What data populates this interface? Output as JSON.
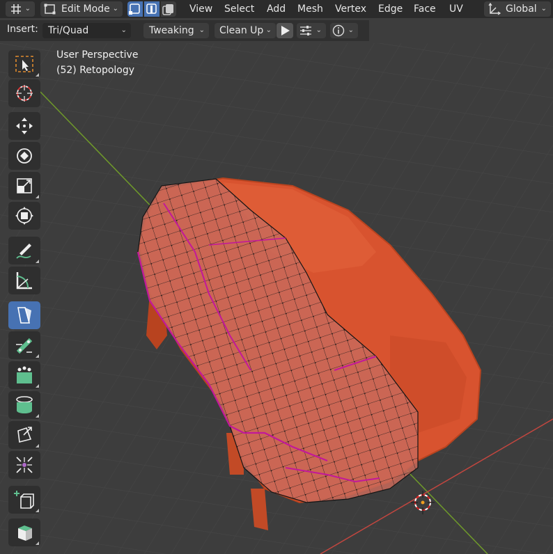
{
  "header": {
    "mode_label": "Edit Mode",
    "menus": [
      "View",
      "Select",
      "Add",
      "Mesh",
      "Vertex",
      "Edge",
      "Face",
      "UV"
    ],
    "orientation_label": "Global"
  },
  "tool_header": {
    "insert_label": "Insert:",
    "insert_value": "Tri/Quad",
    "tweaking_label": "Tweaking",
    "cleanup_label": "Clean Up"
  },
  "viewport": {
    "view_name": "User Perspective",
    "object_info": "(52) Retopology"
  },
  "colors": {
    "accent": "#4772b3",
    "mesh_surface": "#d8532f",
    "retopo_overlay": "#c96a5a",
    "seam_edge": "#c2189a",
    "x_axis": "#c2463f",
    "y_axis": "#6f9a2a"
  },
  "toolbar": {
    "tools": [
      "select-box",
      "cursor",
      "move",
      "rotate",
      "scale",
      "transform",
      "annotate",
      "measure",
      "poly-build",
      "edge-slide",
      "extrude",
      "spin",
      "shrink-fatten",
      "shear",
      "add-cube",
      "cube"
    ],
    "active": "poly-build"
  }
}
